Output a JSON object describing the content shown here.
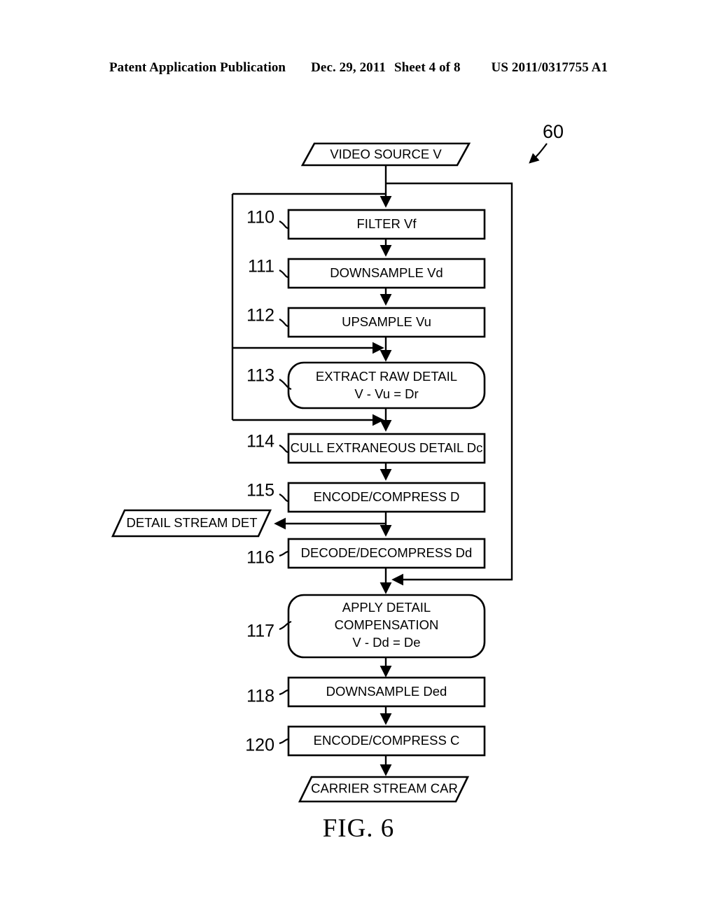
{
  "header": {
    "publication": "Patent Application Publication",
    "date": "Dec. 29, 2011",
    "sheet": "Sheet 4 of 8",
    "number": "US 2011/0317755 A1"
  },
  "figure": {
    "caption": "FIG. 6",
    "diagram_reference": "60"
  },
  "nodes": {
    "video_source": {
      "label": "VIDEO SOURCE V",
      "shape": "parallelogram"
    },
    "n110": {
      "ref": "110",
      "label": "FILTER Vf",
      "shape": "rect"
    },
    "n111": {
      "ref": "111",
      "label": "DOWNSAMPLE Vd",
      "shape": "rect"
    },
    "n112": {
      "ref": "112",
      "label": "UPSAMPLE Vu",
      "shape": "rect"
    },
    "n113": {
      "ref": "113",
      "line1": "EXTRACT RAW DETAIL",
      "line2": "V - Vu = Dr",
      "shape": "rounded-rect"
    },
    "n114": {
      "ref": "114",
      "label": "CULL EXTRANEOUS DETAIL Dc",
      "shape": "rect"
    },
    "n115": {
      "ref": "115",
      "label": "ENCODE/COMPRESS D",
      "shape": "rect"
    },
    "detail_stream": {
      "label": "DETAIL STREAM DET",
      "shape": "parallelogram"
    },
    "n116": {
      "ref": "116",
      "label": "DECODE/DECOMPRESS Dd",
      "shape": "rect"
    },
    "n117": {
      "ref": "117",
      "line1": "APPLY DETAIL",
      "line2": "COMPENSATION",
      "line3": "V - Dd = De",
      "shape": "rounded-rect"
    },
    "n118": {
      "ref": "118",
      "label": "DOWNSAMPLE Ded",
      "shape": "rect"
    },
    "n120": {
      "ref": "120",
      "label": "ENCODE/COMPRESS C",
      "shape": "rect"
    },
    "carrier_stream": {
      "label": "CARRIER STREAM CAR",
      "shape": "parallelogram"
    }
  },
  "chart_data": {
    "type": "diagram",
    "title": "FIG. 6",
    "diagram_kind": "flowchart",
    "reference_numeral": "60",
    "steps": [
      {
        "ref": "",
        "text": "VIDEO SOURCE V",
        "shape": "parallelogram"
      },
      {
        "ref": "110",
        "text": "FILTER Vf",
        "shape": "rect"
      },
      {
        "ref": "111",
        "text": "DOWNSAMPLE Vd",
        "shape": "rect"
      },
      {
        "ref": "112",
        "text": "UPSAMPLE Vu",
        "shape": "rect"
      },
      {
        "ref": "113",
        "text": "EXTRACT RAW DETAIL V - Vu = Dr",
        "shape": "rounded-rect"
      },
      {
        "ref": "114",
        "text": "CULL EXTRANEOUS DETAIL Dc",
        "shape": "rect"
      },
      {
        "ref": "115",
        "text": "ENCODE/COMPRESS D",
        "shape": "rect"
      },
      {
        "ref": "",
        "text": "DETAIL STREAM DET",
        "shape": "parallelogram"
      },
      {
        "ref": "116",
        "text": "DECODE/DECOMPRESS Dd",
        "shape": "rect"
      },
      {
        "ref": "117",
        "text": "APPLY DETAIL COMPENSATION V - Dd = De",
        "shape": "rounded-rect"
      },
      {
        "ref": "118",
        "text": "DOWNSAMPLE Ded",
        "shape": "rect"
      },
      {
        "ref": "120",
        "text": "ENCODE/COMPRESS C",
        "shape": "rect"
      },
      {
        "ref": "",
        "text": "CARRIER STREAM CAR",
        "shape": "parallelogram"
      }
    ],
    "edges": [
      {
        "from": "VIDEO SOURCE V",
        "to": "FILTER Vf"
      },
      {
        "from": "FILTER Vf",
        "to": "DOWNSAMPLE Vd"
      },
      {
        "from": "DOWNSAMPLE Vd",
        "to": "UPSAMPLE Vu"
      },
      {
        "from": "UPSAMPLE Vu",
        "to": "EXTRACT RAW DETAIL"
      },
      {
        "from": "VIDEO SOURCE V",
        "to": "EXTRACT RAW DETAIL",
        "via": "left bus"
      },
      {
        "from": "EXTRACT RAW DETAIL",
        "to": "CULL EXTRANEOUS DETAIL Dc"
      },
      {
        "from": "VIDEO SOURCE V",
        "to": "CULL EXTRANEOUS DETAIL Dc",
        "via": "left bus"
      },
      {
        "from": "CULL EXTRANEOUS DETAIL Dc",
        "to": "ENCODE/COMPRESS D"
      },
      {
        "from": "ENCODE/COMPRESS D",
        "to": "DETAIL STREAM DET"
      },
      {
        "from": "ENCODE/COMPRESS D",
        "to": "DECODE/DECOMPRESS Dd"
      },
      {
        "from": "DECODE/DECOMPRESS Dd",
        "to": "APPLY DETAIL COMPENSATION"
      },
      {
        "from": "VIDEO SOURCE V",
        "to": "APPLY DETAIL COMPENSATION",
        "via": "right bus"
      },
      {
        "from": "APPLY DETAIL COMPENSATION",
        "to": "DOWNSAMPLE Ded"
      },
      {
        "from": "DOWNSAMPLE Ded",
        "to": "ENCODE/COMPRESS C"
      },
      {
        "from": "ENCODE/COMPRESS C",
        "to": "CARRIER STREAM CAR"
      }
    ]
  }
}
